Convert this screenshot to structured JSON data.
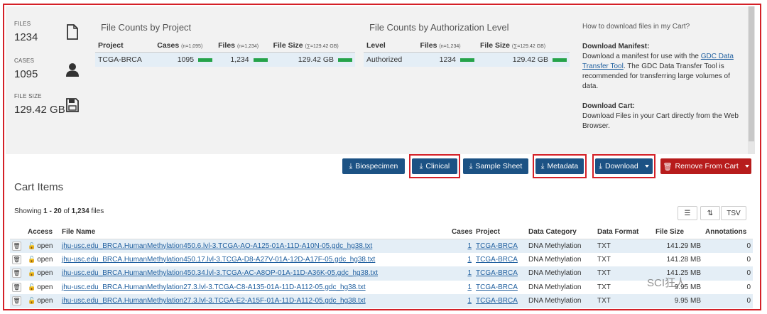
{
  "stats": [
    {
      "label": "FILES",
      "value": "1234",
      "icon": "file-icon"
    },
    {
      "label": "CASES",
      "value": "1095",
      "icon": "user-icon"
    },
    {
      "label": "FILE SIZE",
      "value": "129.42 GB",
      "icon": "save-icon"
    }
  ],
  "project_panel": {
    "title": "File Counts by Project",
    "headers": {
      "project": "Project",
      "cases": "Cases",
      "cases_note": "(n=1,095)",
      "files": "Files",
      "files_note": "(n=1,234)",
      "size": "File Size",
      "size_note": "(∑=129.42 GB)"
    },
    "row": {
      "project": "TCGA-BRCA",
      "cases": "1095",
      "files": "1,234",
      "size": "129.42 GB"
    }
  },
  "auth_panel": {
    "title": "File Counts by Authorization Level",
    "headers": {
      "level": "Level",
      "files": "Files",
      "files_note": "(n=1,234)",
      "size": "File Size",
      "size_note": "(∑=129.42 GB)"
    },
    "row": {
      "level": "Authorized",
      "files": "1234",
      "size": "129.42 GB"
    }
  },
  "help": {
    "title": "How to download files in my Cart?",
    "manifest_heading": "Download Manifest:",
    "manifest_pre": "Download a manifest for use with the ",
    "manifest_link": "GDC Data Transfer Tool",
    "manifest_post": ". The GDC Data Transfer Tool is recommended for transferring large volumes of data.",
    "cart_heading": "Download Cart:",
    "cart_text": "Download Files in your Cart directly from the Web Browser."
  },
  "buttons": {
    "biospecimen": "Biospecimen",
    "clinical": "Clinical",
    "sample_sheet": "Sample Sheet",
    "metadata": "Metadata",
    "download": "Download",
    "remove": "Remove From Cart"
  },
  "cart": {
    "title": "Cart Items",
    "showing_pre": "Showing ",
    "showing_range": "1 - 20",
    "showing_mid": " of ",
    "showing_total": "1,234",
    "showing_post": " files",
    "tsv": "TSV"
  },
  "table": {
    "headers": [
      "Access",
      "File Name",
      "Cases",
      "Project",
      "Data Category",
      "Data Format",
      "File Size",
      "Annotations"
    ],
    "rows": [
      {
        "access": "open",
        "file": "jhu-usc.edu_BRCA.HumanMethylation450.6.lvl-3.TCGA-AO-A125-01A-11D-A10N-05.gdc_hg38.txt",
        "cases": "1",
        "project": "TCGA-BRCA",
        "category": "DNA Methylation",
        "format": "TXT",
        "size": "141.29 MB",
        "annotations": "0"
      },
      {
        "access": "open",
        "file": "jhu-usc.edu_BRCA.HumanMethylation450.17.lvl-3.TCGA-D8-A27V-01A-12D-A17F-05.gdc_hg38.txt",
        "cases": "1",
        "project": "TCGA-BRCA",
        "category": "DNA Methylation",
        "format": "TXT",
        "size": "141.28 MB",
        "annotations": "0"
      },
      {
        "access": "open",
        "file": "jhu-usc.edu_BRCA.HumanMethylation450.34.lvl-3.TCGA-AC-A8OP-01A-11D-A36K-05.gdc_hg38.txt",
        "cases": "1",
        "project": "TCGA-BRCA",
        "category": "DNA Methylation",
        "format": "TXT",
        "size": "141.25 MB",
        "annotations": "0"
      },
      {
        "access": "open",
        "file": "jhu-usc.edu_BRCA.HumanMethylation27.3.lvl-3.TCGA-C8-A135-01A-11D-A112-05.gdc_hg38.txt",
        "cases": "1",
        "project": "TCGA-BRCA",
        "category": "DNA Methylation",
        "format": "TXT",
        "size": "9.95 MB",
        "annotations": "0"
      },
      {
        "access": "open",
        "file": "jhu-usc.edu_BRCA.HumanMethylation27.3.lvl-3.TCGA-E2-A15F-01A-11D-A112-05.gdc_hg38.txt",
        "cases": "1",
        "project": "TCGA-BRCA",
        "category": "DNA Methylation",
        "format": "TXT",
        "size": "9.95 MB",
        "annotations": "0"
      }
    ]
  },
  "watermark": "SCI狂人",
  "colors": {
    "primary": "#1c5284",
    "danger": "#b71c1c",
    "highlight": "#d42027",
    "bar": "#25a34a",
    "row_alt": "#e4eef6"
  }
}
